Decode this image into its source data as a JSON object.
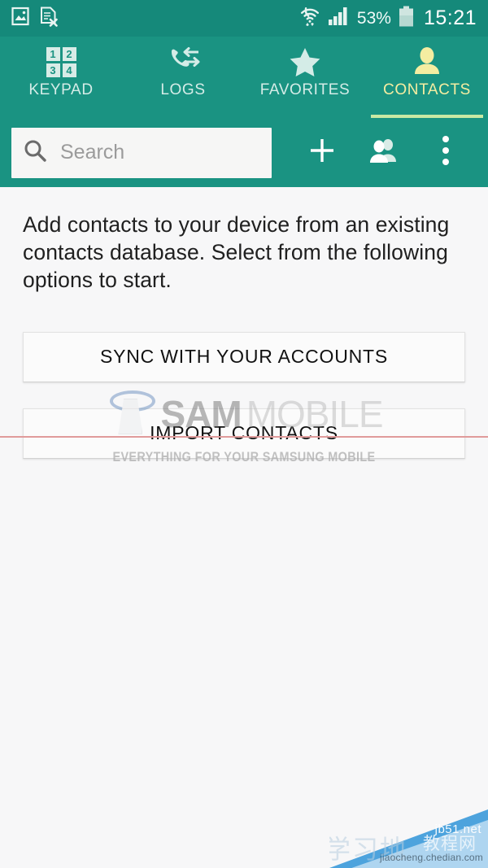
{
  "theme": {
    "status_bar_bg": "#15897a",
    "toolbar_bg": "#1a9382",
    "accent_active": "#f4eda1",
    "tab_underline": "#c9e9a4",
    "content_bg": "#f7f7f8"
  },
  "status_bar": {
    "left_icons": [
      "image-icon",
      "document-error-icon"
    ],
    "wifi_icon": "wifi-icon",
    "signal_icon": "signal-bars-icon",
    "battery_percent": "53%",
    "battery_icon": "battery-icon",
    "clock": "15:21"
  },
  "tabs": [
    {
      "label": "KEYPAD",
      "icon": "keypad-icon",
      "active": false,
      "keys": [
        "1",
        "2",
        "3",
        "4"
      ]
    },
    {
      "label": "LOGS",
      "icon": "call-logs-icon",
      "active": false
    },
    {
      "label": "FAVORITES",
      "icon": "star-icon",
      "active": false
    },
    {
      "label": "CONTACTS",
      "icon": "person-icon",
      "active": true
    }
  ],
  "search": {
    "placeholder": "Search",
    "value": "",
    "icon": "search-icon"
  },
  "actions": [
    {
      "name": "add-contact-button",
      "icon": "plus-icon"
    },
    {
      "name": "groups-button",
      "icon": "group-people-icon"
    },
    {
      "name": "more-options-button",
      "icon": "overflow-menu-icon"
    }
  ],
  "main": {
    "intro_text": "Add contacts to your device from an existing contacts database. Select from the following options to start.",
    "buttons": [
      {
        "label": "SYNC WITH YOUR ACCOUNTS"
      },
      {
        "label": "IMPORT CONTACTS"
      }
    ]
  },
  "watermark": {
    "brand_bold": "SAM",
    "brand_light": "MOBILE",
    "tagline": "EVERYTHING FOR YOUR SAMSUNG MOBILE"
  },
  "corner_watermark": {
    "site": "jb51.net",
    "cn_text": "教程网",
    "url": "jiaocheng.chedian.com",
    "big_cn": "学习地"
  }
}
